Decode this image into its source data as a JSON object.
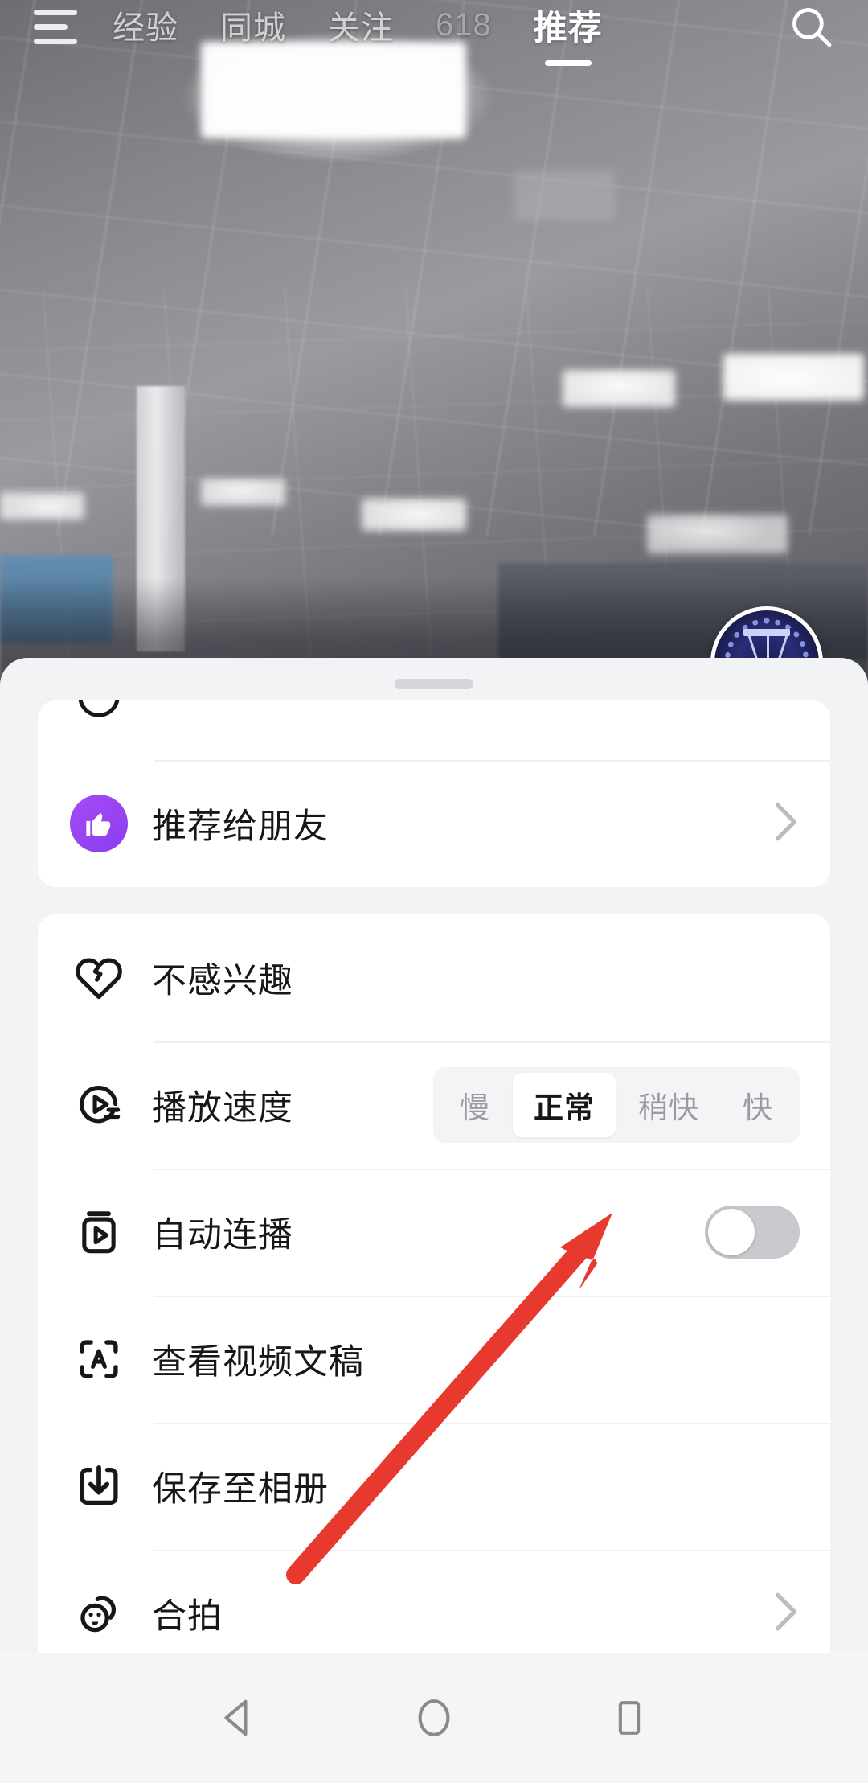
{
  "top_nav": {
    "menu_icon": "hamburger-menu-icon",
    "search_icon": "search-icon",
    "tabs": [
      {
        "label": "经验",
        "active": false,
        "dim": false
      },
      {
        "label": "同城",
        "active": false,
        "dim": false
      },
      {
        "label": "关注",
        "active": false,
        "dim": false
      },
      {
        "label": "618",
        "active": false,
        "dim": true
      },
      {
        "label": "推荐",
        "active": true,
        "dim": false
      }
    ]
  },
  "avatar": {
    "name": "user-avatar"
  },
  "bottom_sheet": {
    "handle": "drag-handle",
    "share_card": {
      "rows": [
        {
          "label": "推荐给朋友",
          "icon": "thumbs-up-icon",
          "accent": "#9a42f2",
          "chevron": "›"
        }
      ]
    },
    "main_card": {
      "rows": [
        {
          "label": "不感兴趣",
          "icon": "broken-heart-icon",
          "type": "plain"
        },
        {
          "label": "播放速度",
          "icon": "playback-speed-icon",
          "type": "segmented"
        },
        {
          "label": "自动连播",
          "icon": "autoplay-icon",
          "type": "toggle"
        },
        {
          "label": "查看视频文稿",
          "icon": "scan-text-icon",
          "type": "plain"
        },
        {
          "label": "保存至相册",
          "icon": "download-icon",
          "type": "plain"
        },
        {
          "label": "合拍",
          "icon": "duet-faces-icon",
          "type": "chevron",
          "chevron": "›"
        }
      ],
      "speed_options": [
        {
          "label": "慢",
          "selected": false
        },
        {
          "label": "正常",
          "selected": true
        },
        {
          "label": "稍快",
          "selected": false
        },
        {
          "label": "快",
          "selected": false
        }
      ],
      "autoplay_toggle": {
        "state": "off"
      }
    }
  },
  "annotation": {
    "arrow": "red-pointer-arrow",
    "color": "#e8392f"
  },
  "android_nav": {
    "buttons": [
      {
        "name": "back-button",
        "icon": "triangle-back-icon"
      },
      {
        "name": "home-button",
        "icon": "circle-home-icon"
      },
      {
        "name": "recents-button",
        "icon": "square-recents-icon"
      }
    ]
  },
  "colors": {
    "sheet_bg": "#f2f3f5",
    "card_bg": "#ffffff",
    "text": "#16171a",
    "muted": "#9a9aa0",
    "toggle_off": "#c9cacd",
    "accent_purple": "#9a42f2",
    "arrow_red": "#e8392f"
  }
}
